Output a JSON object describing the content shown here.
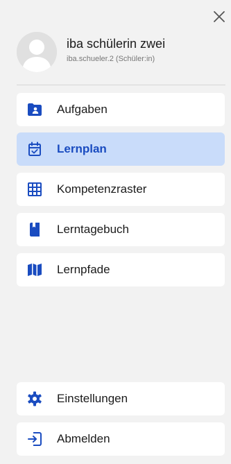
{
  "colors": {
    "background": "#f2f2f2",
    "item_background": "#ffffff",
    "active_background": "#c9dcfa",
    "active_text": "#1a4cc0",
    "icon": "#1a4cc0"
  },
  "user": {
    "name": "iba schülerin zwei",
    "subtitle": "iba.schueler.2 (Schüler:in)"
  },
  "nav": {
    "items": [
      {
        "label": "Aufgaben",
        "icon": "folder-user-icon"
      },
      {
        "label": "Lernplan",
        "icon": "calendar-check-icon",
        "active": true
      },
      {
        "label": "Kompetenzraster",
        "icon": "grid-icon"
      },
      {
        "label": "Lerntagebuch",
        "icon": "book-icon"
      },
      {
        "label": "Lernpfade",
        "icon": "map-icon"
      }
    ]
  },
  "footer": {
    "items": [
      {
        "label": "Einstellungen",
        "icon": "gear-icon"
      },
      {
        "label": "Abmelden",
        "icon": "logout-icon"
      }
    ]
  }
}
